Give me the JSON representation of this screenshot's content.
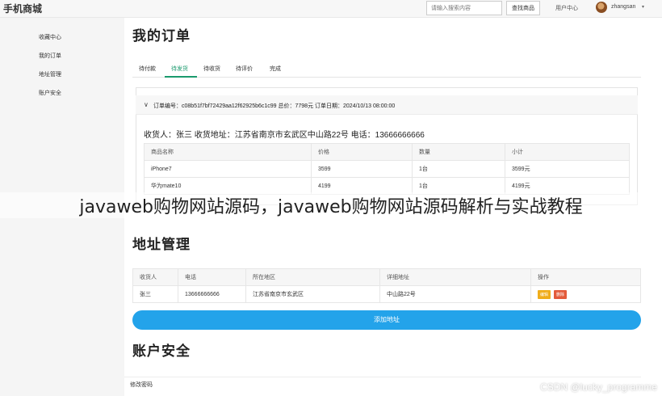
{
  "header": {
    "logo": "手机商城",
    "search_placeholder": "请输入搜索内容",
    "search_button": "查找商品",
    "user_center": "用户中心",
    "username": "zhangsan",
    "caret": "▾"
  },
  "sidebar": {
    "items": [
      {
        "label": "收藏中心"
      },
      {
        "label": "我的订单"
      },
      {
        "label": "地址管理"
      },
      {
        "label": "账户安全"
      }
    ]
  },
  "orders": {
    "title": "我的订单",
    "tabs": [
      {
        "label": "待付款"
      },
      {
        "label": "待发货"
      },
      {
        "label": "待收货"
      },
      {
        "label": "待评价"
      },
      {
        "label": "完成"
      }
    ],
    "active_tab": "待发货",
    "chevron": "∨",
    "order_info": "订单编号：c08b51f7bf72429aa12f62925b6c1c99  总价：7798元  订单日期：2024/10/13 08:00:00",
    "receiver_line": "收货人：张三   收货地址：江苏省南京市玄武区中山路22号  电话：13666666666",
    "columns": [
      "商品名称",
      "价格",
      "数量",
      "小计"
    ],
    "rows": [
      [
        "iPhone7",
        "3599",
        "1台",
        "3599元"
      ],
      [
        "华为mate10",
        "4199",
        "1台",
        "4199元"
      ]
    ]
  },
  "address": {
    "title": "地址管理",
    "columns": [
      "收货人",
      "电话",
      "所在地区",
      "详细地址",
      "操作"
    ],
    "row": {
      "name": "张三",
      "phone": "13666666666",
      "region": "江苏省南京市玄武区",
      "detail": "中山路22号",
      "edit": "编辑",
      "delete": "删除"
    },
    "add_button": "添加地址"
  },
  "account": {
    "title": "账户安全",
    "change_password": "修改密码"
  },
  "overlay_caption": "javaweb购物网站源码，javaweb购物网站源码解析与实战教程",
  "watermark": "CSDN @lucky_programme",
  "colors": {
    "accent_green": "#1a9a6d",
    "primary_blue": "#23a3ea",
    "edit_orange": "#f0ad1a",
    "delete_red": "#e35a3a"
  }
}
